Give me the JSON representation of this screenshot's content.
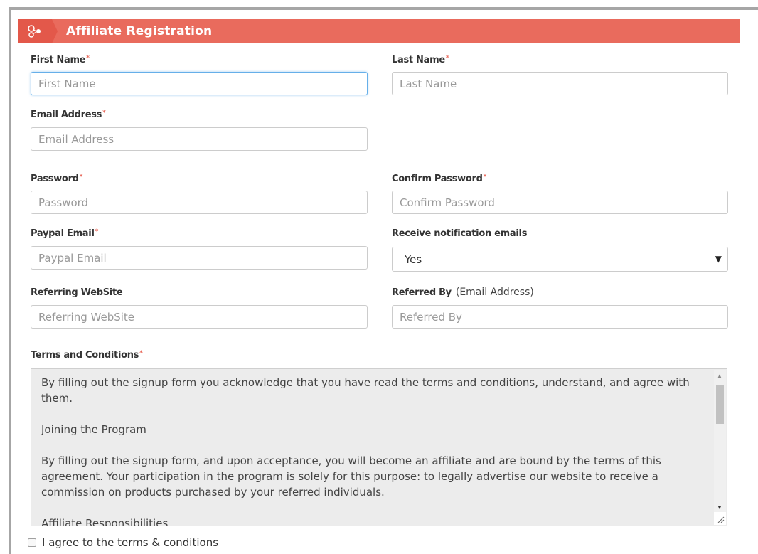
{
  "header": {
    "title": "Affiliate Registration",
    "icon": "affiliate-network-icon"
  },
  "required_marker": "*",
  "fields": {
    "first_name": {
      "label": "First Name",
      "placeholder": "First Name",
      "value": ""
    },
    "last_name": {
      "label": "Last Name",
      "placeholder": "Last Name",
      "value": ""
    },
    "email": {
      "label": "Email Address",
      "placeholder": "Email Address",
      "value": ""
    },
    "password": {
      "label": "Password",
      "placeholder": "Password",
      "value": ""
    },
    "confirm_password": {
      "label": "Confirm Password",
      "placeholder": "Confirm Password",
      "value": ""
    },
    "paypal_email": {
      "label": "Paypal Email",
      "placeholder": "Paypal Email",
      "value": ""
    },
    "notifications": {
      "label": "Receive notification emails",
      "selected": "Yes"
    },
    "referring_website": {
      "label": "Referring WebSite",
      "placeholder": "Referring WebSite",
      "value": ""
    },
    "referred_by": {
      "label": "Referred By",
      "note": "(Email Address)",
      "placeholder": "Referred By",
      "value": ""
    }
  },
  "terms": {
    "label": "Terms and Conditions",
    "paragraphs": [
      "By filling out the signup form you acknowledge that you have read the terms and conditions, understand, and agree with them.",
      "Joining the Program",
      "By filling out the signup form, and upon acceptance, you will become an affiliate and are bound by the terms of this agreement. Your participation in the program is solely for this purpose: to legally advertise our website to receive a commission on products purchased by your referred individuals.",
      "Affiliate Responsibilities"
    ]
  },
  "agree": {
    "label": "I agree to the terms & conditions",
    "checked": false
  },
  "colors": {
    "accent": "#e96b5d",
    "focus": "#66afe9"
  }
}
